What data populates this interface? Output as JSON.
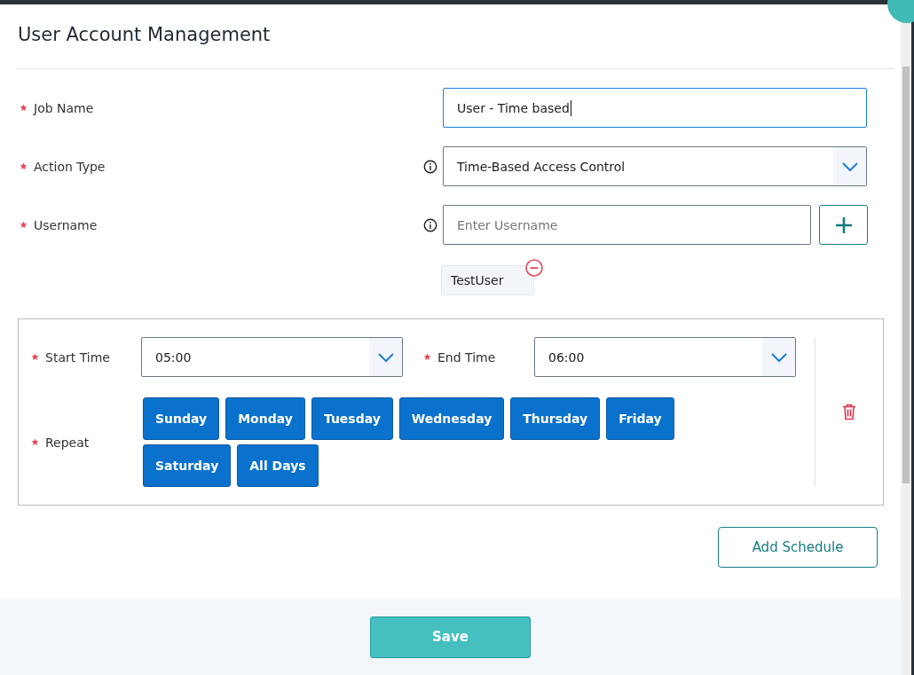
{
  "dialog": {
    "title": "User Account Management"
  },
  "fields": [
    {
      "kind": "text",
      "label": "Job Name",
      "required": true,
      "info": false,
      "value": "User - Time based",
      "focused": true
    },
    {
      "kind": "select",
      "label": "Action Type",
      "required": true,
      "info": true,
      "value": "Time-Based Access Control"
    },
    {
      "kind": "add",
      "label": "Username",
      "required": true,
      "info": true,
      "placeholder": "Enter Username"
    }
  ],
  "user_tags": [
    {
      "label": "TestUser"
    }
  ],
  "schedules": [
    {
      "start_label": "Start Time",
      "start": "05:00",
      "end_label": "End Time",
      "end": "06:00",
      "repeat_label": "Repeat",
      "days": [
        {
          "label": "Sunday",
          "selected": true
        },
        {
          "label": "Monday",
          "selected": true
        },
        {
          "label": "Tuesday",
          "selected": true
        },
        {
          "label": "Wednesday",
          "selected": true
        },
        {
          "label": "Thursday",
          "selected": true
        },
        {
          "label": "Friday",
          "selected": true
        },
        {
          "label": "Saturday",
          "selected": true
        },
        {
          "label": "All Days",
          "selected": true
        }
      ]
    }
  ],
  "add_schedule_button": "Add Schedule",
  "save_button": "Save"
}
